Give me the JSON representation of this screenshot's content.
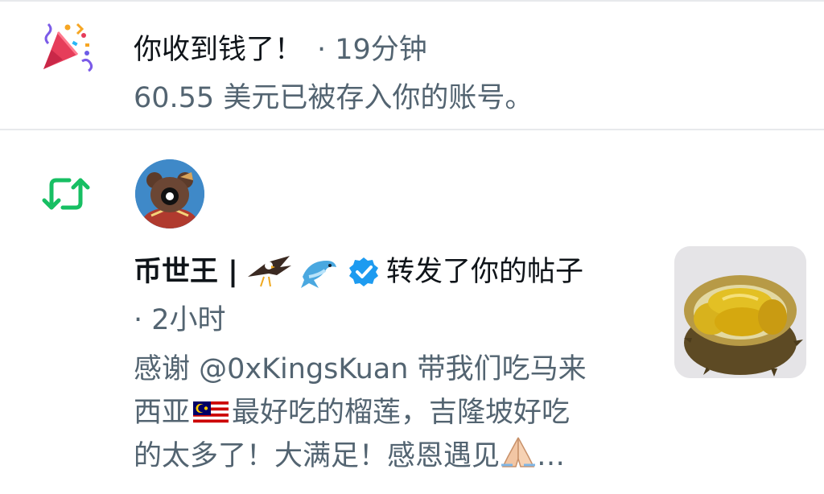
{
  "notification_payment": {
    "icon": "party-popper-icon",
    "title": "你收到钱了！",
    "time": "· 19分钟",
    "message": "60.55 美元已被存入你的账号。"
  },
  "notification_repost": {
    "icon": "retweet-icon",
    "accent_color": "#17bf63",
    "user": {
      "name": "币世王 |",
      "badges": [
        "eagle-icon",
        "dolphin-icon",
        "verified-badge-icon"
      ],
      "verified_color": "#1d9bf0",
      "avatar": "avatar-cartoon-bear"
    },
    "action": "转发了你的帖子",
    "time": "· 2小时",
    "post_lines": [
      "感谢 @0xKingsKuan 带我们吃马来",
      "最好吃的榴莲，吉隆坡好吃",
      "的太多了！大满足！感恩遇见"
    ],
    "post_line2_prefix": "西亚",
    "post_ellipsis": "…",
    "thumbnail": "durian-photo"
  }
}
